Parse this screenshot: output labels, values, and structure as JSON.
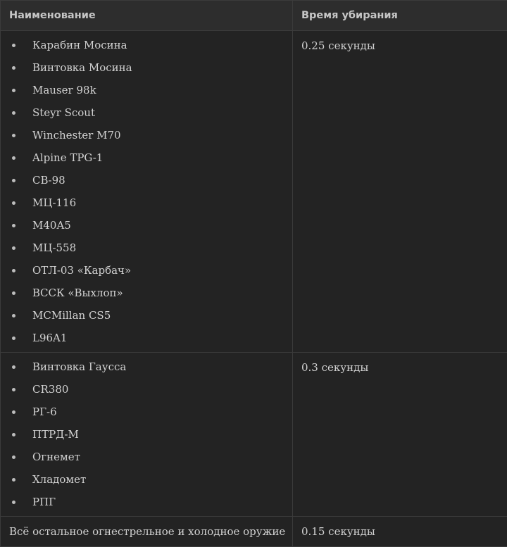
{
  "table": {
    "headers": [
      "Наименование",
      "Время убирания"
    ],
    "rows": [
      {
        "items": [
          "Карабин Мосина",
          "Винтовка Мосина",
          "Mauser 98k",
          "Steyr Scout",
          "Winchester M70",
          "Alpine TPG-1",
          "СВ-98",
          "МЦ-116",
          "M40A5",
          "МЦ-558",
          "ОТЛ-03 «Карбач»",
          "ВССК «Выхлоп»",
          "MCMillan CS5",
          "L96A1"
        ],
        "time": "0.25 секунды"
      },
      {
        "items": [
          "Винтовка Гаусса",
          "CR380",
          "РГ-6",
          "ПТРД-М",
          "Огнемет",
          "Хладомет",
          "РПГ"
        ],
        "time": "0.3 секунды"
      },
      {
        "label": "Всё остальное огнестрельное и холодное оружие",
        "time": "0.15 секунды"
      }
    ]
  }
}
